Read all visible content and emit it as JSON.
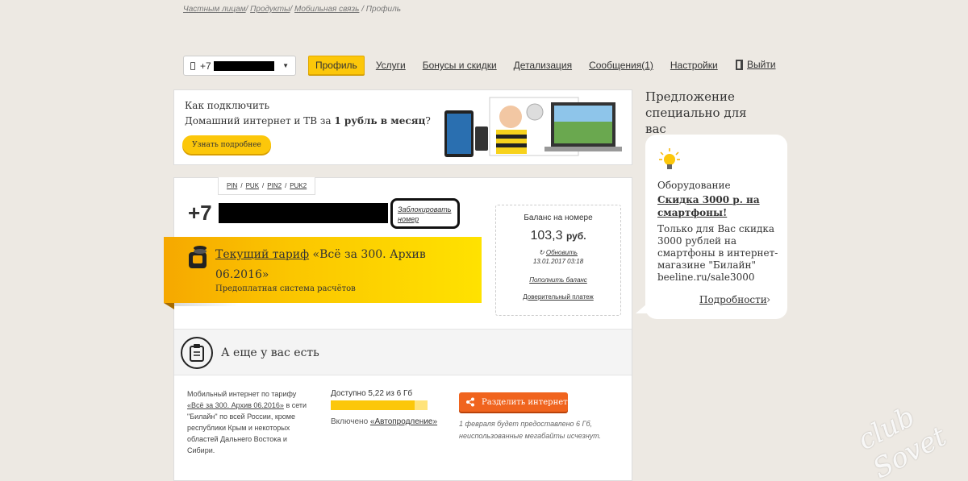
{
  "breadcrumb": {
    "items": [
      "Частным лицам",
      "Продукты",
      "Мобильная связь"
    ],
    "current": "Профиль"
  },
  "header": {
    "phone_prefix": "+7",
    "tabs": [
      {
        "label": "Профиль",
        "active": true
      },
      {
        "label": "Услуги"
      },
      {
        "label": "Бонусы и скидки"
      },
      {
        "label": "Детализация"
      },
      {
        "label": "Сообщения(1)"
      },
      {
        "label": "Настройки"
      }
    ],
    "logout": "Выйти"
  },
  "banner": {
    "line1": "Как подключить",
    "line2_a": "Домашний интернет и ТВ за ",
    "line2_b": "1 рубль в месяц",
    "line2_c": "?",
    "button": "Узнать подробнее"
  },
  "profile": {
    "codes": [
      "PIN",
      "PUK",
      "PIN2",
      "PUK2"
    ],
    "number_prefix": "+7",
    "block_link": "Заблокировать номер",
    "tariff_link": "Текущий тариф",
    "tariff_name": " «Всё за 300. Архив 06.2016»",
    "payment_system": "Предоплатная система расчётов",
    "balance": {
      "label": "Баланс на номере",
      "value": "103,3",
      "currency": "руб.",
      "refresh": "Обновить",
      "date": "13.01.2017 03:18",
      "topup": "Пополнить баланс",
      "trust": "Доверительный платеж"
    }
  },
  "extra": {
    "title": "А еще у вас есть",
    "desc_a": "Мобильный интернет по тарифу",
    "desc_link": "«Всё за 300. Архив 06.2016»",
    "desc_b": "в сети \"Билайн\" по всей России, кроме республики Крым и некоторых областей Дальнего Востока и Сибири.",
    "available": "Доступно 5,22 из 6 Гб",
    "available_fraction": 0.87,
    "included_label": "Включено ",
    "included_link": "«Автопродление»",
    "share_button": "Разделить интернет",
    "note": "1 февраля будет предоставлено 6 Гб, неиспользованные мегабайты исчезнут."
  },
  "offer": {
    "heading": "Предложение специально для вас",
    "title": "Оборудование",
    "link": "Скидка 3000 р. на смартфоны!",
    "text": "Только для Вас скидка 3000 рублей на смартфоны в интернет-магазине \"Билайн\" beeline.ru/sale3000",
    "more": "Подробности"
  },
  "watermark": "club Sovet",
  "colors": {
    "accent": "#fcc70a",
    "orange": "#f0641e",
    "background": "#ede9e3"
  }
}
